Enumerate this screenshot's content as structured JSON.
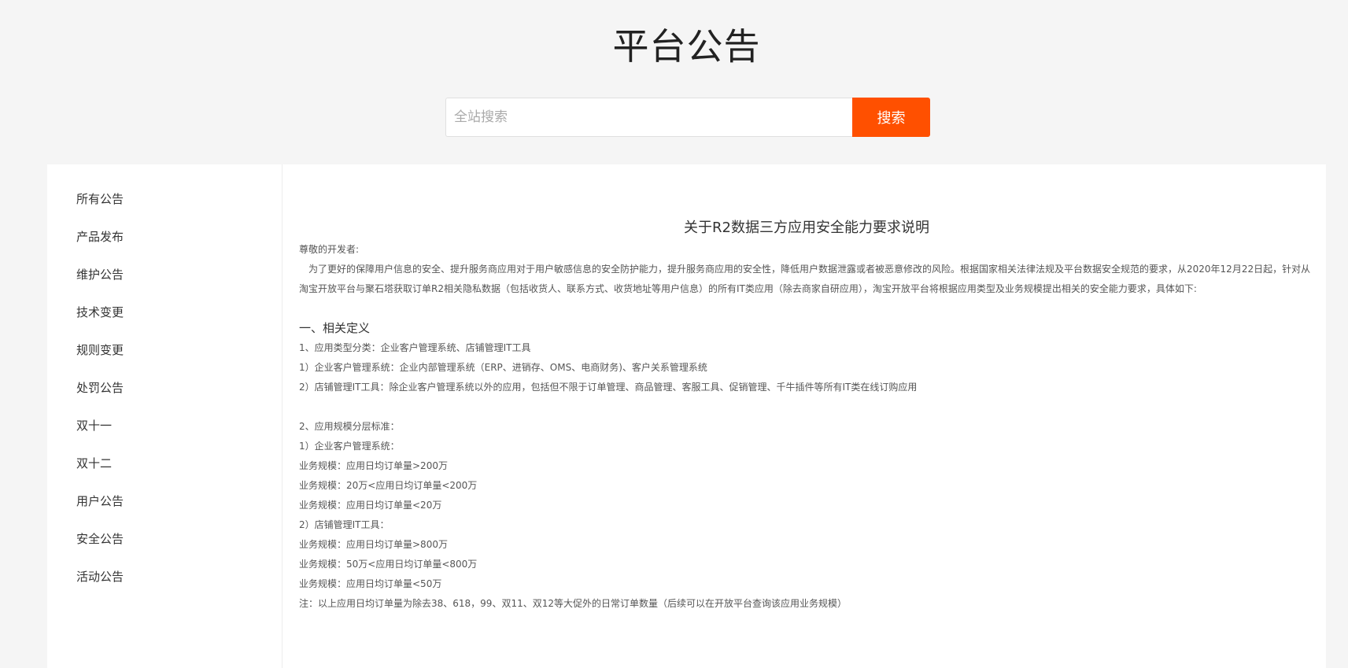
{
  "header": {
    "title": "平台公告"
  },
  "search": {
    "placeholder": "全站搜索",
    "value": "",
    "button_label": "搜索"
  },
  "sidebar": {
    "items": [
      {
        "label": "所有公告"
      },
      {
        "label": "产品发布"
      },
      {
        "label": "维护公告"
      },
      {
        "label": "技术变更"
      },
      {
        "label": "规则变更"
      },
      {
        "label": "处罚公告"
      },
      {
        "label": "双十一"
      },
      {
        "label": "双十二"
      },
      {
        "label": "用户公告"
      },
      {
        "label": "安全公告"
      },
      {
        "label": "活动公告"
      }
    ]
  },
  "article": {
    "title": "关于R2数据三方应用安全能力要求说明",
    "greeting": "尊敬的开发者:",
    "intro": "为了更好的保障用户信息的安全、提升服务商应用对于用户敏感信息的安全防护能力，提升服务商应用的安全性，降低用户数据泄露或者被恶意修改的风险。根据国家相关法律法规及平台数据安全规范的要求，从2020年12月22日起，针对从淘宝开放平台与聚石塔获取订单R2相关隐私数据（包括收货人、联系方式、收货地址等用户信息）的所有IT类应用（除去商家自研应用），淘宝开放平台将根据应用类型及业务规模提出相关的安全能力要求，具体如下:",
    "section1_heading": "一、相关定义",
    "section1_lines": [
      "1、应用类型分类：企业客户管理系统、店铺管理IT工具",
      "1）企业客户管理系统：企业内部管理系统（ERP、进销存、OMS、电商财务)、客户关系管理系统",
      "2）店铺管理IT工具：除企业客户管理系统以外的应用，包括但不限于订单管理、商品管理、客服工具、促销管理、千牛插件等所有IT类在线订购应用"
    ],
    "section2_lines": [
      "2、应用规模分层标准：",
      "1）企业客户管理系统：",
      "业务规模：应用日均订单量>200万",
      "业务规模：20万<应用日均订单量<200万",
      "业务规模：应用日均订单量<20万",
      "2）店铺管理IT工具：",
      "业务规模：应用日均订单量>800万",
      "业务规模：50万<应用日均订单量<800万",
      "业务规模：应用日均订单量<50万",
      "注：以上应用日均订单量为除去38、618，99、双11、双12等大促外的日常订单数量（后续可以在开放平台查询该应用业务规模）"
    ]
  },
  "colors": {
    "accent": "#ff5000",
    "background": "#f5f5f5",
    "card": "#ffffff"
  }
}
